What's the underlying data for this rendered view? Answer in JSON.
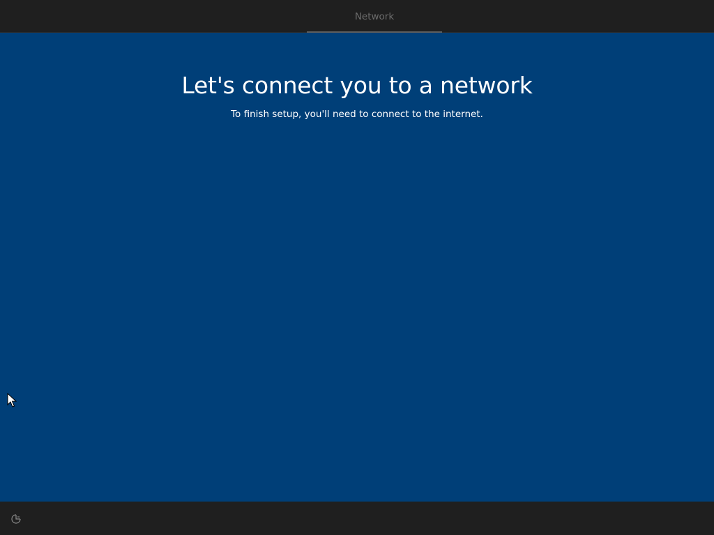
{
  "header": {
    "steps": [
      {
        "label": "Network",
        "active": true
      }
    ]
  },
  "main": {
    "title": "Let's connect you to a network",
    "subtitle": "To finish setup, you'll need to connect to the internet."
  },
  "footer": {
    "icons": [
      "accessibility-icon"
    ]
  },
  "colors": {
    "background": "#003f78",
    "bar": "#1f1f1f",
    "text": "#ffffff",
    "tab_text": "#6c6c6c"
  }
}
